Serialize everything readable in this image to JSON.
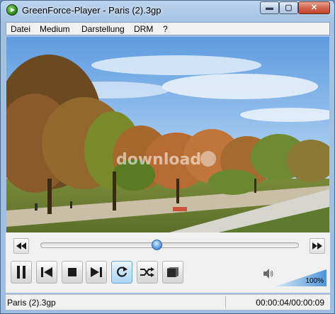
{
  "window": {
    "title": "GreenForce-Player - Paris (2).3gp"
  },
  "titlebar_buttons": {
    "minimize": "▬",
    "maximize": "▢",
    "close": "✕"
  },
  "menu": {
    "items": [
      {
        "label": "Datei"
      },
      {
        "label": "Medium"
      },
      {
        "label": "Darstellung"
      },
      {
        "label": "DRM"
      },
      {
        "label": "?"
      }
    ]
  },
  "video": {
    "watermark": "download"
  },
  "controls": {
    "seek_progress": 0.45,
    "buttons": [
      "pause-icon",
      "prev-frame-icon",
      "stop-icon",
      "next-frame-icon",
      "repeat-icon",
      "shuffle-icon",
      "snapshot-icon"
    ],
    "volume": {
      "level": 1.0,
      "label": "100%"
    }
  },
  "status": {
    "file": "Paris (2).3gp",
    "time": "00:00:04/00:00:09"
  },
  "colors": {
    "accent": "#2a72c6",
    "volume_fill": "#4f94d8",
    "close_button": "#c0422b"
  }
}
